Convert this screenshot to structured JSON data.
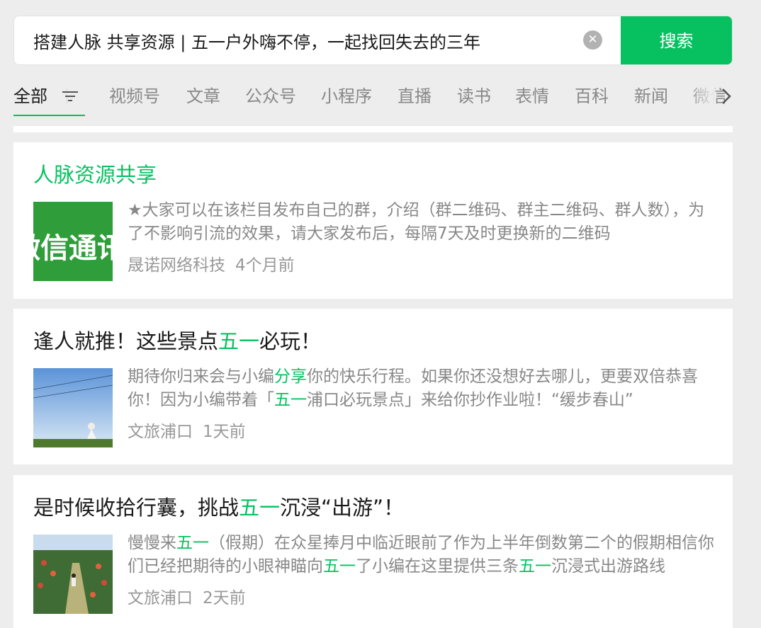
{
  "search": {
    "query": "搭建人脉 共享资源 | 五一户外嗨不停，一起找回失去的三年",
    "clear_icon": "clear-x-icon",
    "button_label": "搜索"
  },
  "tabs": {
    "items": [
      "全部",
      "视频号",
      "文章",
      "公众号",
      "小程序",
      "直播",
      "读书",
      "表情",
      "百科",
      "新闻",
      "微信"
    ],
    "filter_icon": "filter-icon",
    "more_icon": "chevron-right-icon"
  },
  "results": [
    {
      "title": "人脉资源共享",
      "thumb_text": "微信通讯",
      "desc": "★大家可以在该栏目发布自己的群，介绍（群二维码、群主二维码、群人数），为了不影响引流的效果，请大家发布后，每隔7天及时更换新的二维码",
      "source": "晟诺网络科技",
      "time": "4个月前"
    },
    {
      "title": {
        "pre": "逢人就推！这些景点",
        "hl": "五一",
        "post": "必玩！"
      },
      "desc": {
        "p1": "期待你归来会与小编",
        "h1": "分享",
        "p2": "你的快乐行程。如果你还没想好去哪儿，更要双倍恭喜你！因为小编带着「",
        "h2": "五一",
        "p3": "浦口必玩景点」来给你抄作业啦！“缓步春山”"
      },
      "source": "文旅浦口",
      "time": "1天前"
    },
    {
      "title": {
        "pre": "是时候收拾行囊，挑战",
        "hl": "五一",
        "post": "沉浸“出游”！"
      },
      "desc": {
        "p1": "慢慢来",
        "h1": "五一",
        "p2": "（假期）在众星捧月中临近眼前了作为上半年倒数第二个的假期相信你们已经把期待的小眼神瞄向",
        "h2": "五一",
        "p3": "了小编在这里提供三条",
        "h3": "五一",
        "p4": "沉浸式出游路线"
      },
      "source": "文旅浦口",
      "time": "2天前"
    }
  ],
  "colors": {
    "accent": "#07c160",
    "background": "#ededed",
    "card": "#ffffff",
    "muted_text": "#888888"
  }
}
